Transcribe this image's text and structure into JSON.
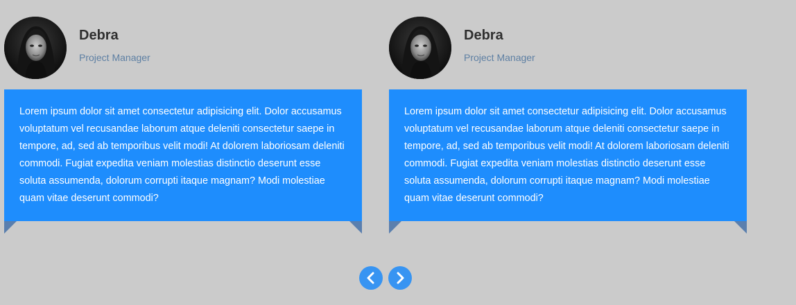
{
  "testimonials": [
    {
      "name": "Debra",
      "role": "Project Manager",
      "quote": "Lorem ipsum dolor sit amet consectetur adipisicing elit. Dolor accusamus voluptatum vel recusandae laborum atque deleniti consectetur saepe in tempore, ad, sed ab temporibus velit modi! At dolorem laboriosam deleniti commodi. Fugiat expedita veniam molestias distinctio deserunt esse soluta assumenda, dolorum corrupti itaque magnam? Modi molestiae quam vitae deserunt commodi?"
    },
    {
      "name": "Debra",
      "role": "Project Manager",
      "quote": "Lorem ipsum dolor sit amet consectetur adipisicing elit. Dolor accusamus voluptatum vel recusandae laborum atque deleniti consectetur saepe in tempore, ad, sed ab temporibus velit modi! At dolorem laboriosam deleniti commodi. Fugiat expedita veniam molestias distinctio deserunt esse soluta assumenda, dolorum corrupti itaque magnam? Modi molestiae quam vitae deserunt commodi?"
    }
  ],
  "navigation": {
    "prev_icon": "chevron-left-icon",
    "next_icon": "chevron-right-icon"
  },
  "colors": {
    "background": "#cbcbcb",
    "quote_box": "#1e8dfd",
    "fold": "#5a7fae",
    "role_text": "#5d7fa3",
    "nav_button": "#3794f2"
  }
}
